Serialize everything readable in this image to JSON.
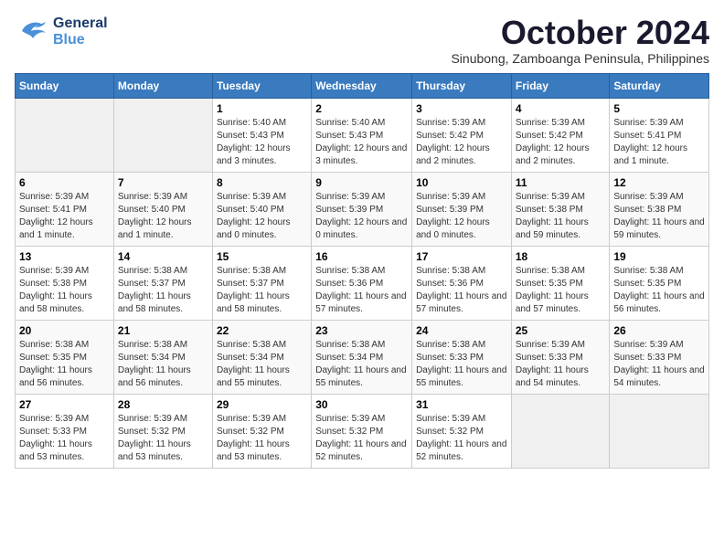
{
  "logo": {
    "line1": "General",
    "line2": "Blue"
  },
  "title": "October 2024",
  "location": "Sinubong, Zamboanga Peninsula, Philippines",
  "weekdays": [
    "Sunday",
    "Monday",
    "Tuesday",
    "Wednesday",
    "Thursday",
    "Friday",
    "Saturday"
  ],
  "weeks": [
    [
      {
        "day": "",
        "info": ""
      },
      {
        "day": "",
        "info": ""
      },
      {
        "day": "1",
        "info": "Sunrise: 5:40 AM\nSunset: 5:43 PM\nDaylight: 12 hours and 3 minutes."
      },
      {
        "day": "2",
        "info": "Sunrise: 5:40 AM\nSunset: 5:43 PM\nDaylight: 12 hours and 3 minutes."
      },
      {
        "day": "3",
        "info": "Sunrise: 5:39 AM\nSunset: 5:42 PM\nDaylight: 12 hours and 2 minutes."
      },
      {
        "day": "4",
        "info": "Sunrise: 5:39 AM\nSunset: 5:42 PM\nDaylight: 12 hours and 2 minutes."
      },
      {
        "day": "5",
        "info": "Sunrise: 5:39 AM\nSunset: 5:41 PM\nDaylight: 12 hours and 1 minute."
      }
    ],
    [
      {
        "day": "6",
        "info": "Sunrise: 5:39 AM\nSunset: 5:41 PM\nDaylight: 12 hours and 1 minute."
      },
      {
        "day": "7",
        "info": "Sunrise: 5:39 AM\nSunset: 5:40 PM\nDaylight: 12 hours and 1 minute."
      },
      {
        "day": "8",
        "info": "Sunrise: 5:39 AM\nSunset: 5:40 PM\nDaylight: 12 hours and 0 minutes."
      },
      {
        "day": "9",
        "info": "Sunrise: 5:39 AM\nSunset: 5:39 PM\nDaylight: 12 hours and 0 minutes."
      },
      {
        "day": "10",
        "info": "Sunrise: 5:39 AM\nSunset: 5:39 PM\nDaylight: 12 hours and 0 minutes."
      },
      {
        "day": "11",
        "info": "Sunrise: 5:39 AM\nSunset: 5:38 PM\nDaylight: 11 hours and 59 minutes."
      },
      {
        "day": "12",
        "info": "Sunrise: 5:39 AM\nSunset: 5:38 PM\nDaylight: 11 hours and 59 minutes."
      }
    ],
    [
      {
        "day": "13",
        "info": "Sunrise: 5:39 AM\nSunset: 5:38 PM\nDaylight: 11 hours and 58 minutes."
      },
      {
        "day": "14",
        "info": "Sunrise: 5:38 AM\nSunset: 5:37 PM\nDaylight: 11 hours and 58 minutes."
      },
      {
        "day": "15",
        "info": "Sunrise: 5:38 AM\nSunset: 5:37 PM\nDaylight: 11 hours and 58 minutes."
      },
      {
        "day": "16",
        "info": "Sunrise: 5:38 AM\nSunset: 5:36 PM\nDaylight: 11 hours and 57 minutes."
      },
      {
        "day": "17",
        "info": "Sunrise: 5:38 AM\nSunset: 5:36 PM\nDaylight: 11 hours and 57 minutes."
      },
      {
        "day": "18",
        "info": "Sunrise: 5:38 AM\nSunset: 5:35 PM\nDaylight: 11 hours and 57 minutes."
      },
      {
        "day": "19",
        "info": "Sunrise: 5:38 AM\nSunset: 5:35 PM\nDaylight: 11 hours and 56 minutes."
      }
    ],
    [
      {
        "day": "20",
        "info": "Sunrise: 5:38 AM\nSunset: 5:35 PM\nDaylight: 11 hours and 56 minutes."
      },
      {
        "day": "21",
        "info": "Sunrise: 5:38 AM\nSunset: 5:34 PM\nDaylight: 11 hours and 56 minutes."
      },
      {
        "day": "22",
        "info": "Sunrise: 5:38 AM\nSunset: 5:34 PM\nDaylight: 11 hours and 55 minutes."
      },
      {
        "day": "23",
        "info": "Sunrise: 5:38 AM\nSunset: 5:34 PM\nDaylight: 11 hours and 55 minutes."
      },
      {
        "day": "24",
        "info": "Sunrise: 5:38 AM\nSunset: 5:33 PM\nDaylight: 11 hours and 55 minutes."
      },
      {
        "day": "25",
        "info": "Sunrise: 5:39 AM\nSunset: 5:33 PM\nDaylight: 11 hours and 54 minutes."
      },
      {
        "day": "26",
        "info": "Sunrise: 5:39 AM\nSunset: 5:33 PM\nDaylight: 11 hours and 54 minutes."
      }
    ],
    [
      {
        "day": "27",
        "info": "Sunrise: 5:39 AM\nSunset: 5:33 PM\nDaylight: 11 hours and 53 minutes."
      },
      {
        "day": "28",
        "info": "Sunrise: 5:39 AM\nSunset: 5:32 PM\nDaylight: 11 hours and 53 minutes."
      },
      {
        "day": "29",
        "info": "Sunrise: 5:39 AM\nSunset: 5:32 PM\nDaylight: 11 hours and 53 minutes."
      },
      {
        "day": "30",
        "info": "Sunrise: 5:39 AM\nSunset: 5:32 PM\nDaylight: 11 hours and 52 minutes."
      },
      {
        "day": "31",
        "info": "Sunrise: 5:39 AM\nSunset: 5:32 PM\nDaylight: 11 hours and 52 minutes."
      },
      {
        "day": "",
        "info": ""
      },
      {
        "day": "",
        "info": ""
      }
    ]
  ]
}
